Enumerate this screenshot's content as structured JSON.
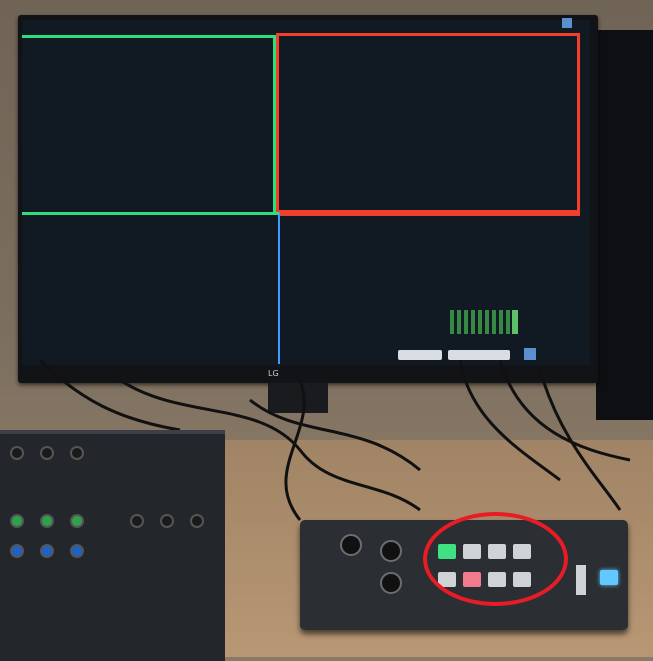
{
  "scene": {
    "monitor_logo": "LG",
    "screen_buttons": [
      "",
      ""
    ],
    "colors": {
      "quad_green": "#2fe07a",
      "quad_red": "#f0402c",
      "quad_blue": "#3aa0ff",
      "highlight": "#e71c25"
    },
    "icons": [
      "corner-icon",
      "corner-icon"
    ]
  }
}
